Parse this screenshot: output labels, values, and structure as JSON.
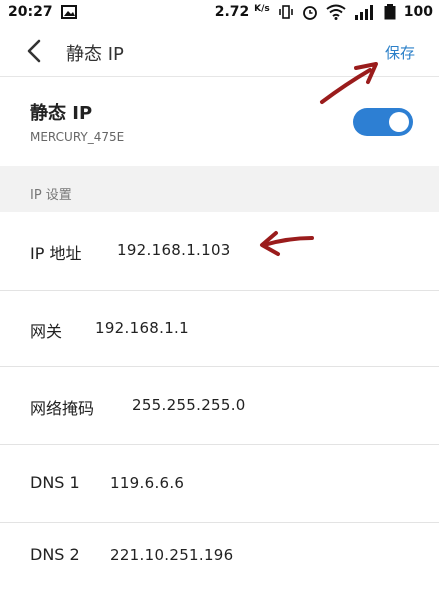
{
  "status_bar": {
    "time": "20:27",
    "speed": "2.72",
    "speed_unit": "K/s",
    "battery": "100",
    "icons": [
      "image-icon",
      "vibrate-icon",
      "alarm-icon",
      "wifi-icon",
      "signal-icon",
      "battery-icon"
    ]
  },
  "app_bar": {
    "title": "静态 IP",
    "save_label": "保存",
    "back_icon": "chevron-left-icon"
  },
  "toggle_row": {
    "title": "静态 IP",
    "network": "MERCURY_475E",
    "enabled": true,
    "accent": "#2d7fd3"
  },
  "section": {
    "title": "IP 设置"
  },
  "fields": [
    {
      "label": "IP 地址",
      "value": "192.168.1.103"
    },
    {
      "label": "网关",
      "value": "192.168.1.1"
    },
    {
      "label": "网络掩码",
      "value": "255.255.255.0"
    },
    {
      "label": "DNS 1",
      "value": "119.6.6.6"
    },
    {
      "label": "DNS 2",
      "value": "221.10.251.196"
    }
  ],
  "annotation_color": "#9a1c1c"
}
